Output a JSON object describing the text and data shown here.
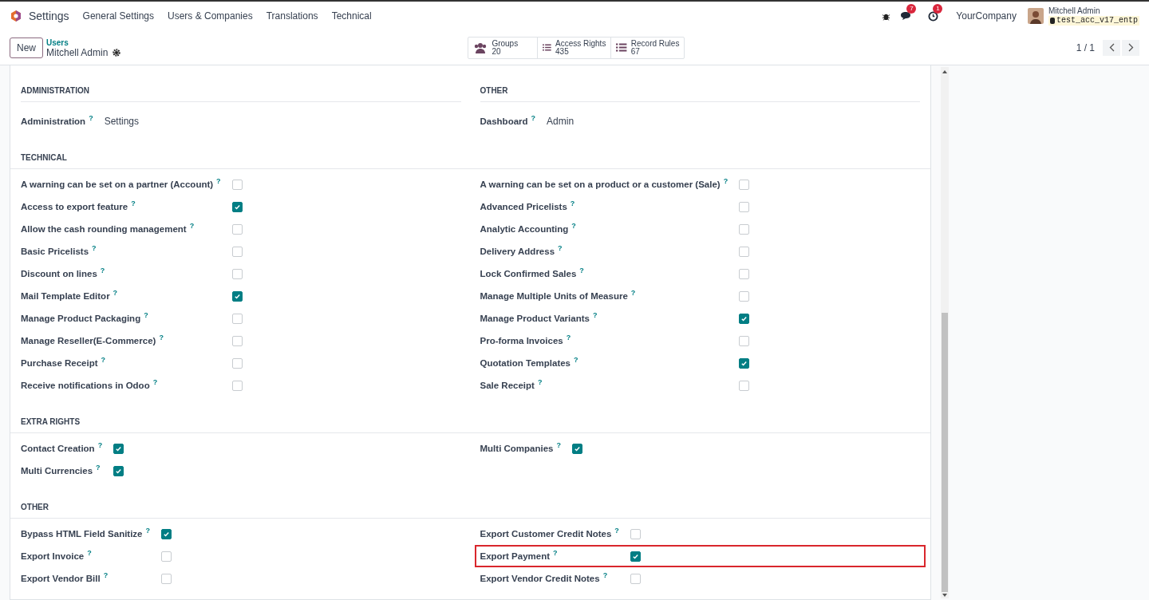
{
  "navbar": {
    "app": "Settings",
    "menus": [
      "General Settings",
      "Users & Companies",
      "Translations",
      "Technical"
    ],
    "messages_badge": "7",
    "activities_badge": "1",
    "company": "YourCompany",
    "user_name": "Mitchell Admin",
    "database": "test_acc_v17_entp"
  },
  "control_panel": {
    "new_button": "New",
    "breadcrumb": "Users",
    "record": "Mitchell Admin",
    "smart_buttons": [
      {
        "kind": "groups",
        "label": "Groups",
        "count": "20"
      },
      {
        "kind": "list",
        "label": "Access Rights",
        "count": "435"
      },
      {
        "kind": "list",
        "label": "Record Rules",
        "count": "67"
      }
    ],
    "pager": "1 / 1"
  },
  "sections": [
    {
      "kind": "split",
      "columns": [
        {
          "title": "ADMINISTRATION",
          "fields": [
            {
              "kind": "value",
              "label": "Administration",
              "help": "?",
              "value": "Settings",
              "highlighted": false
            }
          ]
        },
        {
          "title": "OTHER",
          "fields": [
            {
              "kind": "value",
              "label": "Dashboard",
              "help": "?",
              "value": "Admin",
              "highlighted": false
            }
          ]
        }
      ]
    },
    {
      "kind": "full",
      "title": "TECHNICAL",
      "columns": [
        {
          "fields": [
            {
              "kind": "checkbox",
              "label": "A warning can be set on a partner (Account)",
              "help": "?",
              "checked": false,
              "highlighted": false
            },
            {
              "kind": "checkbox",
              "label": "Access to export feature",
              "help": "?",
              "checked": true,
              "highlighted": false
            },
            {
              "kind": "checkbox",
              "label": "Allow the cash rounding management",
              "help": "?",
              "checked": false,
              "highlighted": false
            },
            {
              "kind": "checkbox",
              "label": "Basic Pricelists",
              "help": "?",
              "checked": false,
              "highlighted": false
            },
            {
              "kind": "checkbox",
              "label": "Discount on lines",
              "help": "?",
              "checked": false,
              "highlighted": false
            },
            {
              "kind": "checkbox",
              "label": "Mail Template Editor",
              "help": "?",
              "checked": true,
              "highlighted": false
            },
            {
              "kind": "checkbox",
              "label": "Manage Product Packaging",
              "help": "?",
              "checked": false,
              "highlighted": false
            },
            {
              "kind": "checkbox",
              "label": "Manage Reseller(E-Commerce)",
              "help": "?",
              "checked": false,
              "highlighted": false
            },
            {
              "kind": "checkbox",
              "label": "Purchase Receipt",
              "help": "?",
              "checked": false,
              "highlighted": false
            },
            {
              "kind": "checkbox",
              "label": "Receive notifications in Odoo",
              "help": "?",
              "checked": false,
              "highlighted": false
            }
          ]
        },
        {
          "fields": [
            {
              "kind": "checkbox",
              "label": "A warning can be set on a product or a customer (Sale)",
              "help": "?",
              "checked": false,
              "highlighted": false
            },
            {
              "kind": "checkbox",
              "label": "Advanced Pricelists",
              "help": "?",
              "checked": false,
              "highlighted": false
            },
            {
              "kind": "checkbox",
              "label": "Analytic Accounting",
              "help": "?",
              "checked": false,
              "highlighted": false
            },
            {
              "kind": "checkbox",
              "label": "Delivery Address",
              "help": "?",
              "checked": false,
              "highlighted": false
            },
            {
              "kind": "checkbox",
              "label": "Lock Confirmed Sales",
              "help": "?",
              "checked": false,
              "highlighted": false
            },
            {
              "kind": "checkbox",
              "label": "Manage Multiple Units of Measure",
              "help": "?",
              "checked": false,
              "highlighted": false
            },
            {
              "kind": "checkbox",
              "label": "Manage Product Variants",
              "help": "?",
              "checked": true,
              "highlighted": false
            },
            {
              "kind": "checkbox",
              "label": "Pro-forma Invoices",
              "help": "?",
              "checked": false,
              "highlighted": false
            },
            {
              "kind": "checkbox",
              "label": "Quotation Templates",
              "help": "?",
              "checked": true,
              "highlighted": false
            },
            {
              "kind": "checkbox",
              "label": "Sale Receipt",
              "help": "?",
              "checked": false,
              "highlighted": false
            }
          ]
        }
      ]
    },
    {
      "kind": "full",
      "title": "EXTRA RIGHTS",
      "columns": [
        {
          "fields": [
            {
              "kind": "checkbox",
              "label": "Contact Creation",
              "help": "?",
              "checked": true,
              "highlighted": false
            },
            {
              "kind": "checkbox",
              "label": "Multi Currencies",
              "help": "?",
              "checked": true,
              "highlighted": false
            }
          ]
        },
        {
          "fields": [
            {
              "kind": "checkbox",
              "label": "Multi Companies",
              "help": "?",
              "checked": true,
              "highlighted": false
            }
          ]
        }
      ]
    },
    {
      "kind": "full",
      "title": "OTHER",
      "columns": [
        {
          "fields": [
            {
              "kind": "checkbox",
              "label": "Bypass HTML Field Sanitize",
              "help": "?",
              "checked": true,
              "highlighted": false
            },
            {
              "kind": "checkbox",
              "label": "Export Invoice",
              "help": "?",
              "checked": false,
              "highlighted": false
            },
            {
              "kind": "checkbox",
              "label": "Export Vendor Bill",
              "help": "?",
              "checked": false,
              "highlighted": false
            }
          ]
        },
        {
          "fields": [
            {
              "kind": "checkbox",
              "label": "Export Customer Credit Notes",
              "help": "?",
              "checked": false,
              "highlighted": false
            },
            {
              "kind": "checkbox",
              "label": "Export Payment",
              "help": "?",
              "checked": true,
              "highlighted": true
            },
            {
              "kind": "checkbox",
              "label": "Export Vendor Credit Notes",
              "help": "?",
              "checked": false,
              "highlighted": false
            }
          ]
        }
      ]
    }
  ]
}
